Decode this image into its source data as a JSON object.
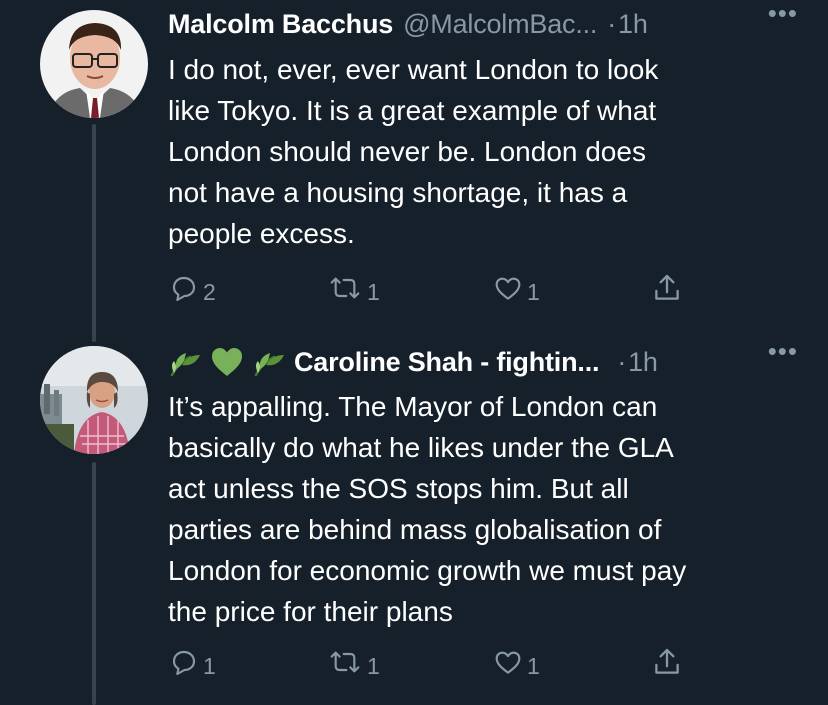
{
  "tweets": [
    {
      "name": "Malcolm Bacchus",
      "handle": "@MalcolmBac...",
      "separator": "·",
      "time": "1h",
      "more": "•••",
      "text": "I do not, ever, ever want London  to look\nlike Tokyo.  It is a great example of what\nLondon should never be.  London  does\nnot have a housing shortage, it has a\npeople excess.",
      "replies": "2",
      "retweets": "1",
      "likes": "1",
      "avatar": "man-with-glasses-avatar"
    },
    {
      "name": "Caroline Shah - fightin...",
      "emojis": [
        "herb-emoji",
        "green-heart-emoji",
        "herb-emoji"
      ],
      "separator": "·",
      "time": "1h",
      "more": "•••",
      "text": "It’s appalling. The Mayor of London can\nbasically do what he likes under the GLA\nact unless the SOS stops him. But all\nparties are behind mass globalisation of\nLondon for economic growth we must pay\nthe price for their plans",
      "replies": "1",
      "retweets": "1",
      "likes": "1",
      "avatar": "woman-outdoors-avatar"
    }
  ],
  "colors": {
    "background": "#15202b",
    "text": "#ffffff",
    "secondary": "#8899a6",
    "thread_line": "#38444d"
  }
}
